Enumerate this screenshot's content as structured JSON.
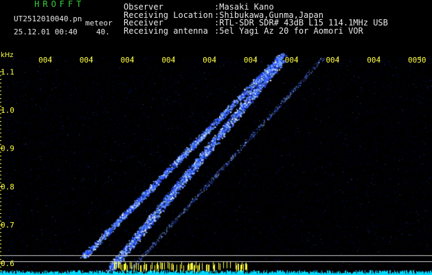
{
  "header": {
    "app_name": "HROFFT",
    "file_name": "UT2512010040.pn",
    "event_type": "meteor",
    "date_time": "25.12.01 00:40",
    "count": "40."
  },
  "metadata": {
    "labels": [
      "Observer",
      "Receiving Location",
      "Receiver",
      "Receiving antenna"
    ],
    "values": [
      ":Masaki Kano",
      ":Shibukawa,Gunma,Japan",
      ":RTL-SDR SDR# 43dB L15 114.1MHz USB",
      ":5el Yagi Az 20 for Aomori VOR"
    ]
  },
  "colors": {
    "background": "#000000",
    "text": "#e8e8e8",
    "title": "#39d039",
    "axis": "#ffff40",
    "signal": "#4fa8ff",
    "baseline": "#00d8ff"
  },
  "chart_data": {
    "type": "heatmap",
    "ylabel": "kHz",
    "time_ticks": [
      "004",
      "004",
      "004",
      "004",
      "004",
      "004",
      "004",
      "004",
      "004",
      "0050"
    ],
    "freq_ticks": [
      "1.1",
      "1.0",
      "0.9",
      "0.8",
      "0.7",
      "0.6"
    ],
    "freq_values": [
      1.1,
      1.0,
      0.9,
      0.8,
      0.7,
      0.6
    ],
    "ylim": [
      0.58,
      1.14
    ],
    "reference_lines_khz": [
      0.62,
      0.604
    ]
  }
}
